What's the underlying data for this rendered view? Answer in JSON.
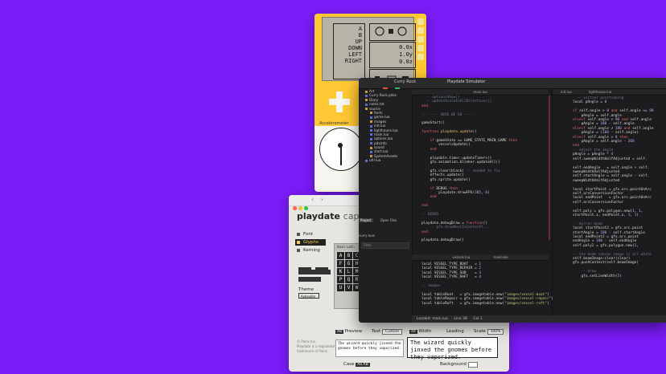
{
  "colors": {
    "background": "#7a1cf7",
    "playdate_yellow": "#ffc833",
    "editor_bg": "#1c1c1e"
  },
  "simulator": {
    "controls": [
      "A",
      "B",
      "UP",
      "DOWN",
      "LEFT",
      "RIGHT"
    ],
    "readouts": [
      "0.0x",
      "1.0y",
      "0.0z"
    ],
    "accelerometer_label": "Accelerometer"
  },
  "caps": {
    "brand": "playdate",
    "brand_suffix": "caps",
    "menu": [
      "Font",
      "Glyphs",
      "Kerning"
    ],
    "glyph_header": "Basic Latin",
    "glyphs": [
      "A",
      "B",
      "C",
      "D",
      "E",
      "F",
      "G",
      "H",
      "I",
      "J",
      "K",
      "L",
      "M",
      "N",
      "O",
      "P",
      "Q",
      "R",
      "S",
      "T",
      "U",
      "V",
      "W",
      "X",
      "Y"
    ],
    "theme_label": "Theme",
    "theme_value": "Asheville",
    "footer": "© Panic Inc.\nPlaydate is a registered\ntrademark of Panic",
    "preview_label": "Preview",
    "text_label": "Text",
    "text_value": "Custom",
    "width_label": "Width",
    "leading_label": "Leading",
    "scale_label": "Scale",
    "scale_value": "100%",
    "case_label": "Case",
    "background_label": "Background",
    "sample_text": "The wizard quickly jinxed the gnomes before they vaporized."
  },
  "ide": {
    "project": "Curry Rock",
    "sim_title": "Playdate Simulator",
    "files": [
      {
        "name": "Art",
        "type": "folder"
      },
      {
        "name": "Curry Rock.pdxs",
        "type": "file"
      },
      {
        "name": "Diary",
        "type": "folder"
      },
      {
        "name": "notes.txt",
        "type": "file"
      },
      {
        "name": "source",
        "type": "folder"
      },
      {
        "name": "fonts",
        "type": "folder"
      },
      {
        "name": "game.lua",
        "type": "file"
      },
      {
        "name": "images",
        "type": "folder"
      },
      {
        "name": "init.lua",
        "type": "file"
      },
      {
        "name": "lighthouse.lua",
        "type": "file"
      },
      {
        "name": "main.lua",
        "type": "file"
      },
      {
        "name": "options.lua",
        "type": "file"
      },
      {
        "name": "pdxinfo",
        "type": "file"
      },
      {
        "name": "sound",
        "type": "folder"
      },
      {
        "name": "start.lua",
        "type": "file"
      },
      {
        "name": "SystemAssets",
        "type": "folder"
      },
      {
        "name": "util.lua",
        "type": "file"
      }
    ],
    "sidebar_tabs": [
      "Project",
      "Open Files",
      "curry-luas"
    ],
    "filter_placeholder": "Filter",
    "tab_main": "main.lua",
    "tab_right": [
      "init.lua",
      "lighthouse.lua"
    ],
    "tab_bottom": [
      "vessels.lua",
      "mailcode"
    ],
    "status": [
      "Loaded: main.lua",
      "Line 38",
      "Col 1"
    ],
    "sim_bar": "Playdate ▸ 1 ▸ Load Game"
  }
}
